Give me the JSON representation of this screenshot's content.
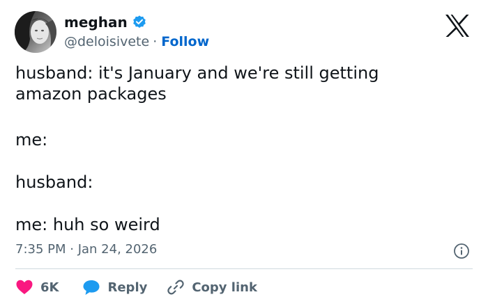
{
  "user": {
    "display_name": "meghan",
    "handle": "@deloisivete",
    "separator": "·",
    "follow_label": "Follow"
  },
  "tweet": {
    "lines": [
      "husband: it's January and we're still getting amazon packages",
      "me:",
      "husband:",
      "me: huh so weird"
    ],
    "timestamp": "7:35 PM · Jan 24, 2026"
  },
  "actions": {
    "like_count": "6K",
    "reply_label": "Reply",
    "copy_link_label": "Copy link"
  },
  "colors": {
    "follow": "#0066cc",
    "like": "#f91880",
    "reply": "#1d9bf0",
    "muted": "#536471",
    "verified": "#1d9bf0"
  },
  "icons": [
    "verified-badge-icon",
    "x-logo-icon",
    "info-icon",
    "heart-icon",
    "reply-bubble-icon",
    "link-icon"
  ]
}
